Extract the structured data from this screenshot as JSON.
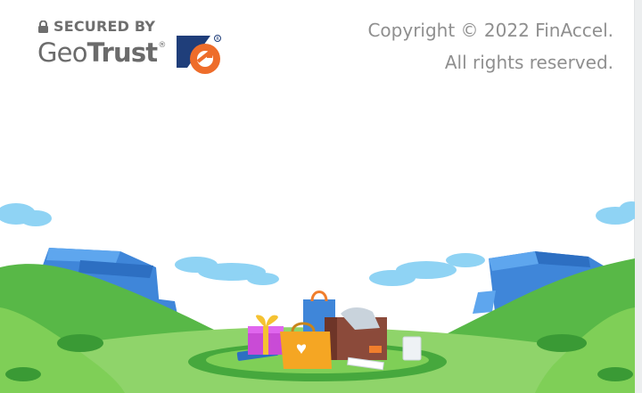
{
  "badge": {
    "secured_label": "SECURED BY",
    "brand_regular": "Geo",
    "brand_bold": "Trust",
    "registered_mark": "®"
  },
  "footer": {
    "copyright_line1": "Copyright © 2022 FinAccel.",
    "copyright_line2": "All rights reserved."
  },
  "icons": [
    "lock-icon",
    "geotrust-logo-icon"
  ],
  "colors": {
    "sky_cloud": "#8fd3f4",
    "hill_green": "#4cae3f",
    "hill_light": "#7fcf57",
    "shop_blue": "#3f86d9",
    "geotrust_navy": "#1f3e7a",
    "geotrust_orange": "#ee6d2b"
  }
}
